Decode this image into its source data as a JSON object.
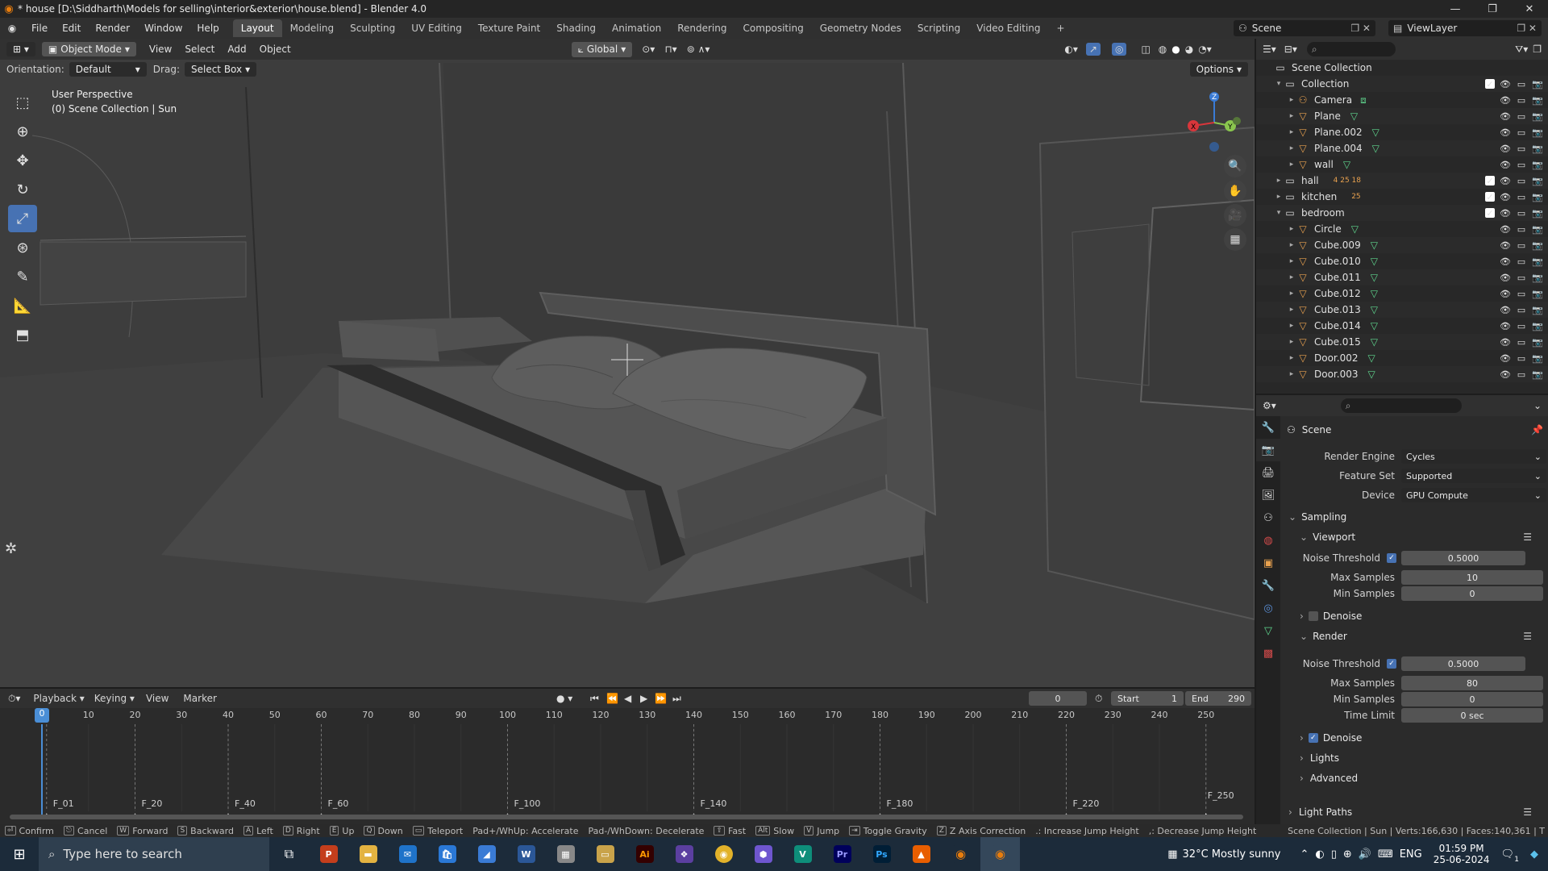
{
  "titlebar": {
    "title": "* house [D:\\Siddharth\\Models for selling\\interior&exterior\\house.blend] - Blender 4.0"
  },
  "menus": [
    "File",
    "Edit",
    "Render",
    "Window",
    "Help"
  ],
  "workspaces": [
    "Layout",
    "Modeling",
    "Sculpting",
    "UV Editing",
    "Texture Paint",
    "Shading",
    "Animation",
    "Rendering",
    "Compositing",
    "Geometry Nodes",
    "Scripting",
    "Video Editing"
  ],
  "active_workspace": "Layout",
  "scene_field": "Scene",
  "viewlayer_field": "ViewLayer",
  "viewport": {
    "mode": "Object Mode",
    "header_menus": [
      "View",
      "Select",
      "Add",
      "Object"
    ],
    "transform_orientation": "Global",
    "orientation_label": "Orientation:",
    "orientation_value": "Default",
    "drag_label": "Drag:",
    "drag_value": "Select Box",
    "options_label": "Options",
    "info_line1": "User Perspective",
    "info_line2": "(0) Scene Collection | Sun",
    "gizmo": {
      "x": "X",
      "y": "Y",
      "z": "Z"
    }
  },
  "outliner": {
    "root": "Scene Collection",
    "rows": [
      {
        "label": "Collection",
        "depth": 1,
        "kind": "collection",
        "expanded": true
      },
      {
        "label": "Camera",
        "depth": 2,
        "kind": "camera"
      },
      {
        "label": "Plane",
        "depth": 2,
        "kind": "mesh"
      },
      {
        "label": "Plane.002",
        "depth": 2,
        "kind": "mesh"
      },
      {
        "label": "Plane.004",
        "depth": 2,
        "kind": "mesh"
      },
      {
        "label": "wall",
        "depth": 2,
        "kind": "mesh"
      },
      {
        "label": "hall",
        "depth": 1,
        "kind": "collection",
        "expanded": false,
        "badges": "4  25  18"
      },
      {
        "label": "kitchen",
        "depth": 1,
        "kind": "collection",
        "expanded": false,
        "badges": "25"
      },
      {
        "label": "bedroom",
        "depth": 1,
        "kind": "collection",
        "expanded": true
      },
      {
        "label": "Circle",
        "depth": 2,
        "kind": "mesh"
      },
      {
        "label": "Cube.009",
        "depth": 2,
        "kind": "mesh"
      },
      {
        "label": "Cube.010",
        "depth": 2,
        "kind": "mesh"
      },
      {
        "label": "Cube.011",
        "depth": 2,
        "kind": "mesh"
      },
      {
        "label": "Cube.012",
        "depth": 2,
        "kind": "mesh"
      },
      {
        "label": "Cube.013",
        "depth": 2,
        "kind": "mesh"
      },
      {
        "label": "Cube.014",
        "depth": 2,
        "kind": "mesh"
      },
      {
        "label": "Cube.015",
        "depth": 2,
        "kind": "mesh"
      },
      {
        "label": "Door.002",
        "depth": 2,
        "kind": "mesh"
      },
      {
        "label": "Door.003",
        "depth": 2,
        "kind": "mesh"
      }
    ]
  },
  "properties": {
    "context": "Scene",
    "render_engine_label": "Render Engine",
    "render_engine": "Cycles",
    "feature_set_label": "Feature Set",
    "feature_set": "Supported",
    "device_label": "Device",
    "device": "GPU Compute",
    "sampling": "Sampling",
    "viewport": "Viewport",
    "noise_threshold_label": "Noise Threshold",
    "vp_noise_threshold": "0.5000",
    "max_samples_label": "Max Samples",
    "vp_max_samples": "10",
    "min_samples_label": "Min Samples",
    "vp_min_samples": "0",
    "denoise": "Denoise",
    "render": "Render",
    "r_noise_threshold": "0.5000",
    "r_max_samples": "80",
    "r_min_samples": "0",
    "time_limit_label": "Time Limit",
    "time_limit": "0 sec",
    "lights": "Lights",
    "advanced": "Advanced",
    "light_paths": "Light Paths"
  },
  "timeline": {
    "menus": [
      "Playback",
      "Keying",
      "View",
      "Marker"
    ],
    "current_frame": "0",
    "start_label": "Start",
    "start": "1",
    "end_label": "End",
    "end": "290",
    "ticks": [
      "0",
      "10",
      "20",
      "30",
      "40",
      "50",
      "60",
      "70",
      "80",
      "90",
      "100",
      "110",
      "120",
      "130",
      "140",
      "150",
      "160",
      "170",
      "180",
      "190",
      "200",
      "210",
      "220",
      "230",
      "240",
      "250"
    ],
    "markers": [
      "F_01",
      "F_20",
      "F_40",
      "F_60",
      "F_100",
      "F_140",
      "F_180",
      "F_220",
      "F_250"
    ]
  },
  "statusbar": {
    "items": [
      {
        "key": "⏎",
        "label": "Confirm"
      },
      {
        "key": "⎋",
        "label": "Cancel"
      },
      {
        "key": "W",
        "label": "Forward"
      },
      {
        "key": "S",
        "label": "Backward"
      },
      {
        "key": "A",
        "label": "Left"
      },
      {
        "key": "D",
        "label": "Right"
      },
      {
        "key": "E",
        "label": "Up"
      },
      {
        "key": "Q",
        "label": "Down"
      },
      {
        "key": "▭",
        "label": "Teleport"
      },
      {
        "key": "",
        "label": "Pad+/WhUp: Accelerate"
      },
      {
        "key": "",
        "label": "Pad-/WhDown: Decelerate"
      },
      {
        "key": "⇧",
        "label": "Fast"
      },
      {
        "key": "Alt",
        "label": "Slow"
      },
      {
        "key": "V",
        "label": "Jump"
      },
      {
        "key": "⇥",
        "label": "Toggle Gravity"
      },
      {
        "key": "Z",
        "label": "Z Axis Correction"
      },
      {
        "key": "",
        "label": ".: Increase Jump Height"
      },
      {
        "key": "",
        "label": ",: Decrease Jump Height"
      }
    ],
    "stats": "Scene Collection | Sun | Verts:166,630 | Faces:140,361 | T"
  },
  "taskbar": {
    "search_placeholder": "Type here to search",
    "weather": "32°C  Mostly sunny",
    "lang": "ENG",
    "time": "01:59 PM",
    "date": "25-06-2024",
    "notif_count": "1"
  },
  "colors": {
    "accent": "#4772b3",
    "mesh_icon": "#5fd68e",
    "object_icon": "#e8a14f",
    "axis_x": "#d8363b",
    "axis_y": "#8ac64e",
    "axis_z": "#3a7bd5",
    "playhead": "#4a8ed6"
  }
}
